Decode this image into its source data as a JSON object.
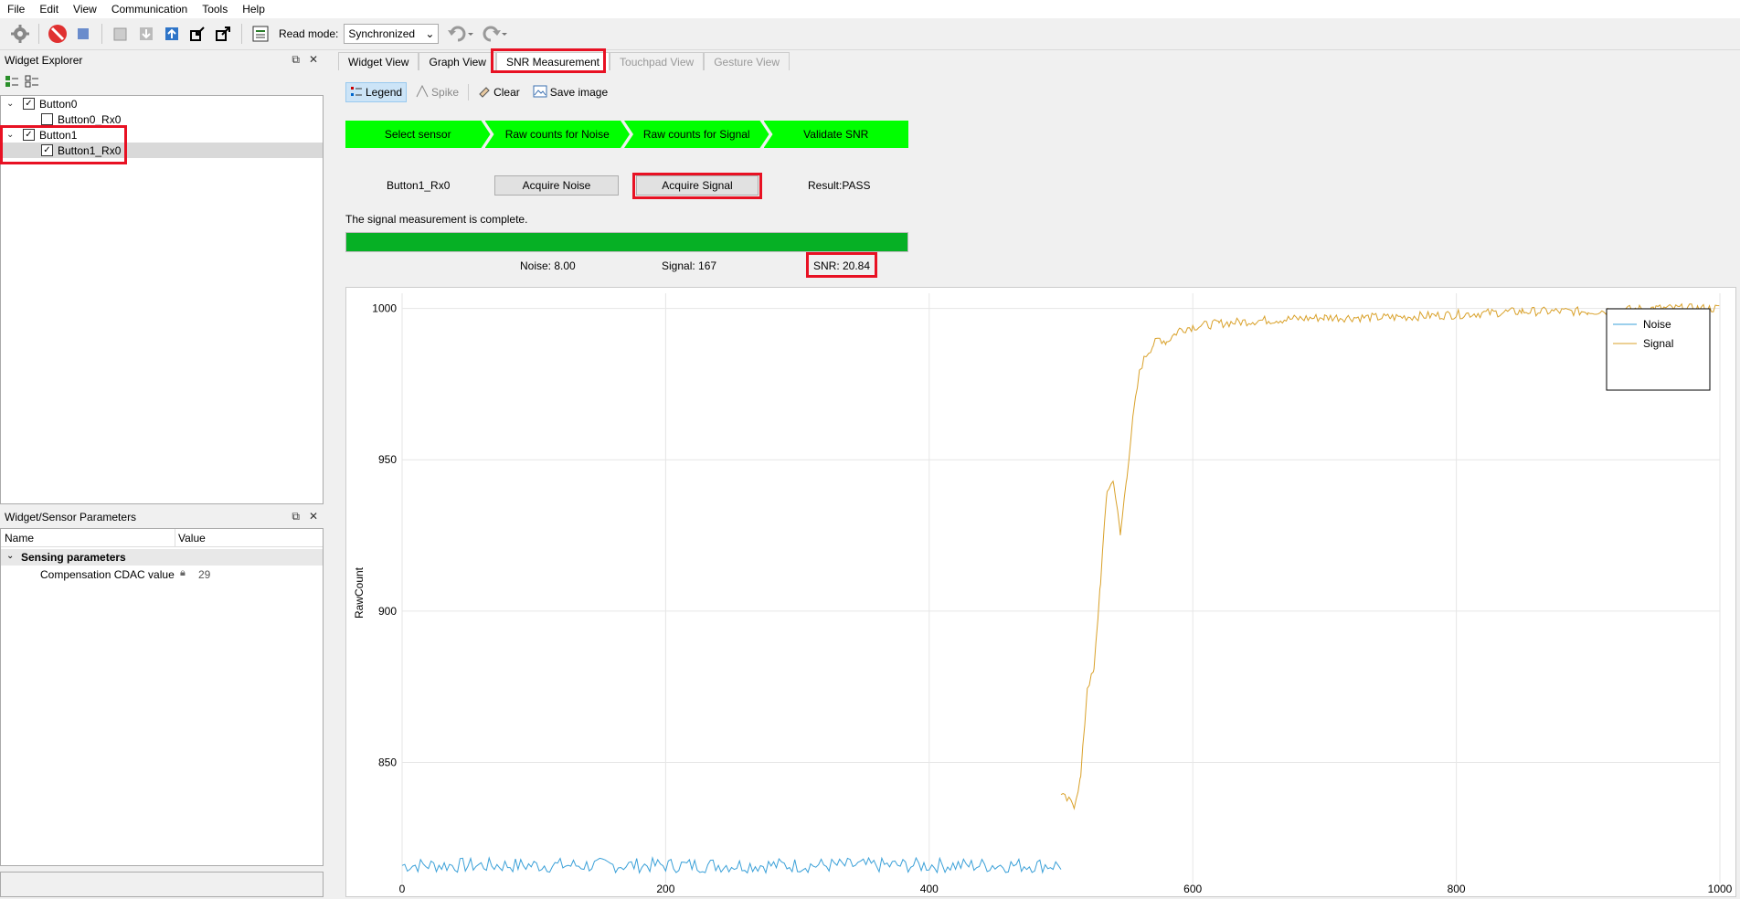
{
  "menu": [
    "File",
    "Edit",
    "View",
    "Communication",
    "Tools",
    "Help"
  ],
  "toolbar": {
    "read_mode_label": "Read mode:",
    "read_mode_value": "Synchronized"
  },
  "widget_explorer": {
    "title": "Widget Explorer",
    "tree": [
      {
        "label": "Button0",
        "checked": true,
        "children": [
          {
            "label": "Button0_Rx0",
            "checked": false
          }
        ]
      },
      {
        "label": "Button1",
        "checked": true,
        "children": [
          {
            "label": "Button1_Rx0",
            "checked": true
          }
        ]
      }
    ]
  },
  "params": {
    "title": "Widget/Sensor Parameters",
    "col_name": "Name",
    "col_value": "Value",
    "group": "Sensing parameters",
    "row_name": "Compensation CDAC value",
    "row_value": "29"
  },
  "tabs": [
    "Widget View",
    "Graph View",
    "SNR Measurement",
    "Touchpad View",
    "Gesture View"
  ],
  "snr_toolbar": {
    "legend": "Legend",
    "spike": "Spike",
    "clear": "Clear",
    "save": "Save image"
  },
  "steps": [
    "Select sensor",
    "Raw counts for Noise",
    "Raw counts for Signal",
    "Validate SNR"
  ],
  "sensor": "Button1_Rx0",
  "acquire_noise": "Acquire Noise",
  "acquire_signal": "Acquire Signal",
  "result": "Result:PASS",
  "status_message": "The signal measurement is complete.",
  "progress": 1.0,
  "stats": {
    "noise": "Noise:  8.00",
    "signal": "Signal:  167",
    "snr": "SNR:  20.84"
  },
  "colors": {
    "noise": "#3aa0d8",
    "signal": "#d9a12a",
    "step": "#00ff00",
    "progress": "#06b025",
    "highlight": "#e81123"
  },
  "chart_data": {
    "type": "line",
    "xlabel": "",
    "ylabel": "RawCount",
    "xlim": [
      0,
      1000
    ],
    "ylim": [
      810,
      1005
    ],
    "xticks": [
      0,
      200,
      400,
      600,
      800,
      1000
    ],
    "yticks": [
      850,
      900,
      950,
      1000
    ],
    "grid": true,
    "legend": "top-right",
    "series": [
      {
        "name": "Noise",
        "x_range": [
          0,
          500
        ],
        "mean": 816,
        "amplitude": 2.5
      },
      {
        "name": "Signal",
        "x": [
          500,
          510,
          515,
          520,
          525,
          530,
          535,
          540,
          545,
          550,
          555,
          560,
          565,
          570,
          575,
          580,
          590,
          600,
          620,
          650,
          700,
          750,
          800,
          850,
          900,
          950,
          1000
        ],
        "y": [
          839,
          836,
          845,
          875,
          880,
          910,
          940,
          943,
          925,
          945,
          965,
          980,
          985,
          988,
          990,
          989,
          993,
          994,
          995,
          996,
          997,
          997,
          998,
          999,
          999,
          1000,
          1000
        ]
      }
    ]
  }
}
